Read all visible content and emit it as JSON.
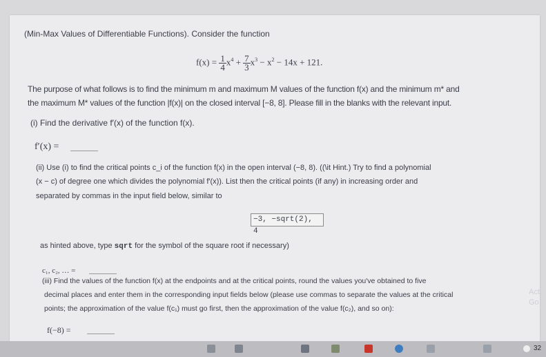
{
  "problem": {
    "header": "(Min-Max Values of Differentiable Functions). Consider the function",
    "function_lhs": "f(x) =",
    "frac1_num": "1",
    "frac1_den": "4",
    "term1": "x",
    "term1_exp": "4",
    "plus": "+",
    "frac2_num": "7",
    "frac2_den": "3",
    "term2": "x",
    "term2_exp": "3",
    "minus1": "− x",
    "term3_exp": "2",
    "rest": " − 14x + 121.",
    "purpose_line1": "The purpose of what follows is to find the minimum m and maximum M values of the function f(x) and the minimum m* and",
    "purpose_line2": "the maximum M* values of the function |f(x)| on the closed interval [−8, 8]. Please fill in the blanks with the relevant input."
  },
  "part1": {
    "instruction": "(i) Find the derivative f′(x) of the function f(x).",
    "answer_label": "f′(x) ="
  },
  "part2": {
    "line1": "(ii) Use (i) to find the critical points c_i of the function f(x) in the open interval (−8, 8). ((\\it Hint.) Try to find a polynomial",
    "line2": "(x − c) of degree one which divides the polynomial f′(x)). List then the critical points (if any) in increasing order and",
    "line3": "separated by commas in the input field below, similar to",
    "example_box": "−3, −sqrt(2), 4",
    "hint_prefix": "as hinted above, type ",
    "hint_code": "sqrt",
    "hint_suffix": " for the symbol of the square root if necessary)",
    "answer_label": "c₁, c₂, … ="
  },
  "part3": {
    "line1": "(iii) Find the values of the function f(x) at the endpoints and at the critical points, round the values you've obtained to five",
    "line2": "decimal places and enter them in the corresponding input fields below (please use commas to separate the values at the critical",
    "line3": "points; the approximation of the value f(c₁) must go first, then the approximation of the value f(c₂), and so on):",
    "answer_label": "f(−8) ="
  },
  "taskbar": {
    "clock": "32",
    "icons": [
      "search-icon",
      "taskview-icon",
      "calculator-icon",
      "store-icon",
      "mail-icon",
      "browser-icon",
      "settings-icon",
      "pinned-icon"
    ]
  },
  "watermark": {
    "line1": "Act",
    "line2": "Go"
  },
  "colors": {
    "page": "#ecebee",
    "background": "#d9d8da",
    "text": "#3b3d48",
    "taskbar": "#bdbcc0"
  }
}
